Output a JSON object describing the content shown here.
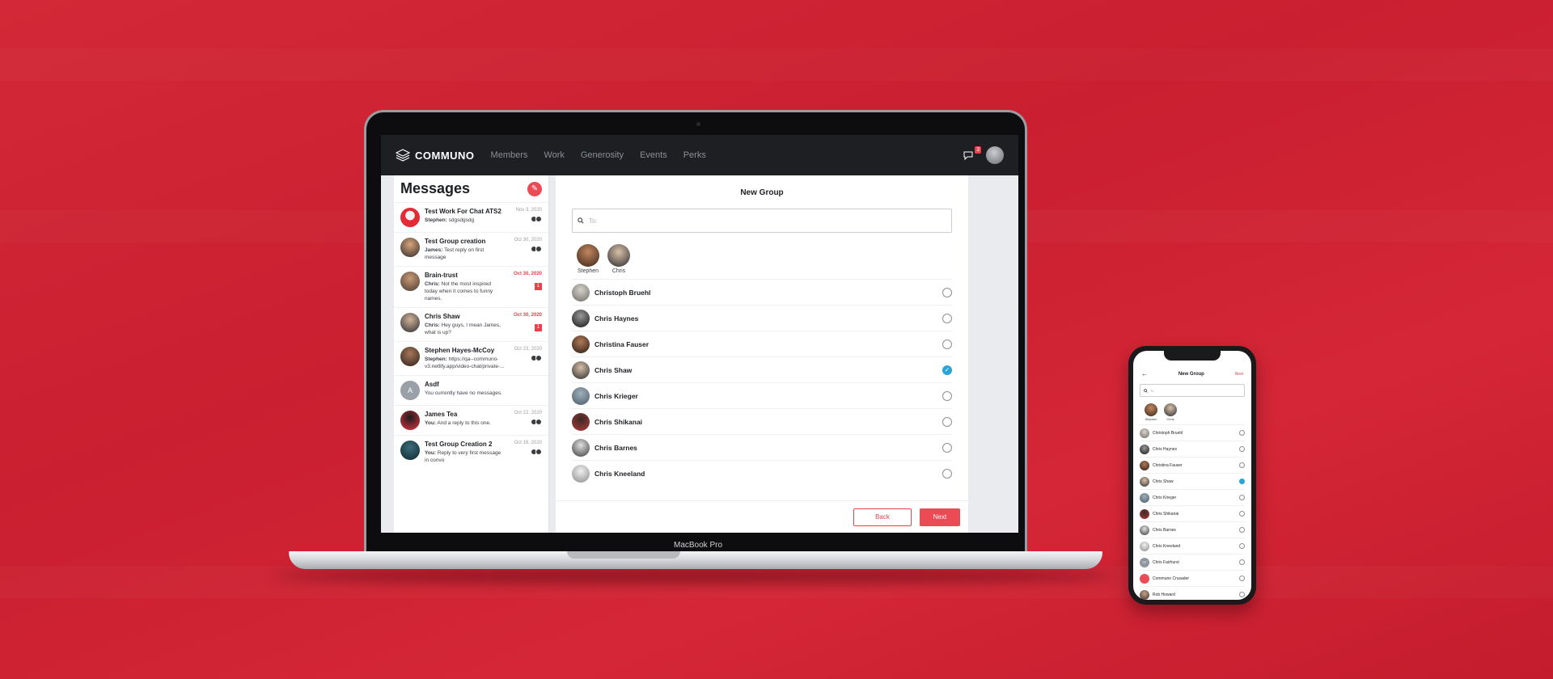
{
  "laptop": {
    "label": "MacBook Pro"
  },
  "header": {
    "brand": "COMMUNO",
    "nav": [
      "Members",
      "Work",
      "Generosity",
      "Events",
      "Perks"
    ],
    "notification_count": "3"
  },
  "messages": {
    "title": "Messages",
    "conversations": [
      {
        "title": "Test Work For Chat ATS2",
        "sender": "Stephen:",
        "preview": "sdgsdgsdg",
        "date": "Nov 3, 2020",
        "unread": "",
        "highlight": false
      },
      {
        "title": "Test Group creation",
        "sender": "James:",
        "preview": "Test reply on first message",
        "date": "Oct 30, 2020",
        "unread": "",
        "highlight": false
      },
      {
        "title": "Brain-trust",
        "sender": "Chris:",
        "preview": "Not the most inspired today when it comes to funny names.",
        "date": "Oct 30, 2020",
        "unread": "1",
        "highlight": true
      },
      {
        "title": "Chris Shaw",
        "sender": "Chris:",
        "preview": "Hey guys, I mean James, what is up?",
        "date": "Oct 30, 2020",
        "unread": "1",
        "highlight": true
      },
      {
        "title": "Stephen Hayes-McCoy",
        "sender": "Stephen:",
        "preview": "https://qa--communo-v3.netlify.app/video-chat/private-...",
        "date": "Oct 23, 2020",
        "unread": "",
        "highlight": false
      },
      {
        "title": "Asdf",
        "sender": "",
        "preview": "You currently have no messages.",
        "date": "",
        "unread": "",
        "highlight": false,
        "initial": "A"
      },
      {
        "title": "James Tea",
        "sender": "You:",
        "preview": "And a reply to this one.",
        "date": "Oct 22, 2020",
        "unread": "",
        "highlight": false
      },
      {
        "title": "Test Group Creation 2",
        "sender": "You:",
        "preview": "Reply to very first message in convo",
        "date": "Oct 16, 2020",
        "unread": "",
        "highlight": false
      }
    ]
  },
  "new_group": {
    "title": "New Group",
    "to_placeholder": "To:",
    "selected": [
      "Stephen",
      "Chris"
    ],
    "people": [
      {
        "name": "Christoph Bruehl",
        "checked": false
      },
      {
        "name": "Chris Haynes",
        "checked": false
      },
      {
        "name": "Christina Fauser",
        "checked": false
      },
      {
        "name": "Chris Shaw",
        "checked": true
      },
      {
        "name": "Chris Krieger",
        "checked": false
      },
      {
        "name": "Chris Shikanai",
        "checked": false
      },
      {
        "name": "Chris Barnes",
        "checked": false
      },
      {
        "name": "Chris Kneeland",
        "checked": false
      }
    ],
    "back_label": "Back",
    "next_label": "Next"
  },
  "phone": {
    "title": "New Group",
    "next_label": "Next",
    "to_placeholder": "To:",
    "selected": [
      "Stephen",
      "Chris"
    ],
    "people": [
      {
        "name": "Christoph Bruehl",
        "checked": false
      },
      {
        "name": "Chris Haynes",
        "checked": false
      },
      {
        "name": "Christina Fauser",
        "checked": false
      },
      {
        "name": "Chris Shaw",
        "checked": true
      },
      {
        "name": "Chris Krieger",
        "checked": false
      },
      {
        "name": "Chris Shikanai",
        "checked": false
      },
      {
        "name": "Chris Barnes",
        "checked": false
      },
      {
        "name": "Chris Kneeland",
        "checked": false
      },
      {
        "name": "Chris Fairhurst",
        "checked": false,
        "initial": "CF"
      },
      {
        "name": "Communo Crusader",
        "checked": false
      },
      {
        "name": "Rob Howard",
        "checked": false
      }
    ]
  },
  "colors": {
    "accent": "#ec4a55",
    "check": "#2aa3d6",
    "header_bg": "#1d1f23"
  }
}
